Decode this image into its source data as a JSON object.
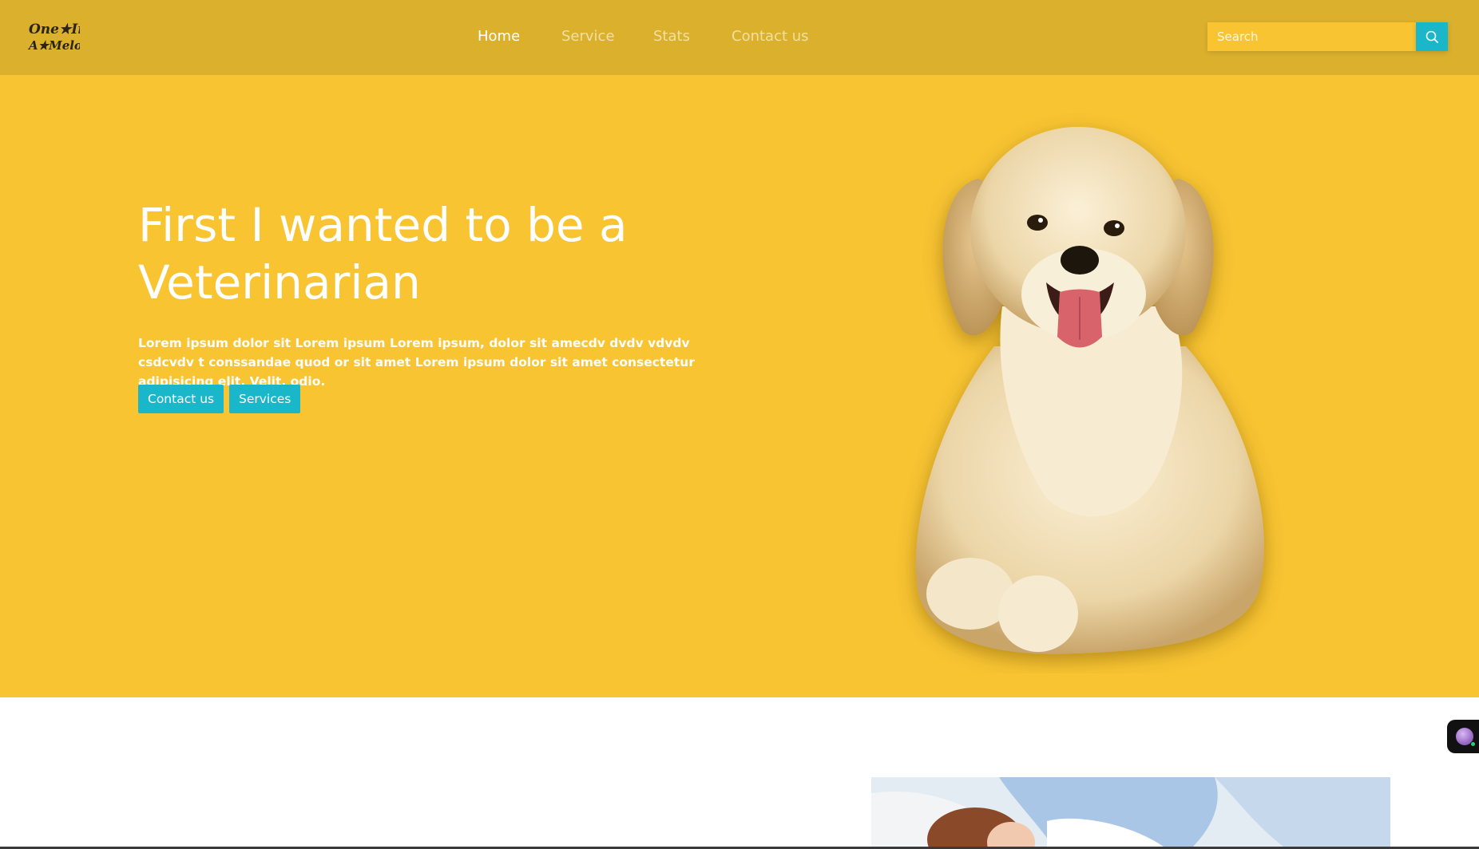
{
  "logo": {
    "text_line1": "One★In",
    "text_line2": "A★Melon"
  },
  "nav": {
    "links": [
      {
        "label": "Home",
        "active": true
      },
      {
        "label": "Service",
        "active": false
      },
      {
        "label": "Stats",
        "active": false
      },
      {
        "label": "Contact us",
        "active": false
      }
    ]
  },
  "search": {
    "placeholder": "Search",
    "value": "",
    "icon": "search-icon"
  },
  "hero": {
    "title": "First I wanted to be a Veterinarian",
    "text": "Lorem ipsum dolor sit Lorem ipsum Lorem ipsum, dolor sit amecdv dvdv vdvdv csdcvdv t conssandae quod or sit amet Lorem ipsum dolor sit amet consectetur adipisicing elit. Velit, odio.",
    "buttons": {
      "contact_label": "Contact us",
      "services_label": "Services"
    },
    "image": "puppy"
  },
  "colors": {
    "navbar": "#dbb02c",
    "hero_bg": "#f8c432",
    "accent": "#1ab6c9"
  },
  "chat_widget": {
    "icon": "chat-avatar-icon"
  }
}
